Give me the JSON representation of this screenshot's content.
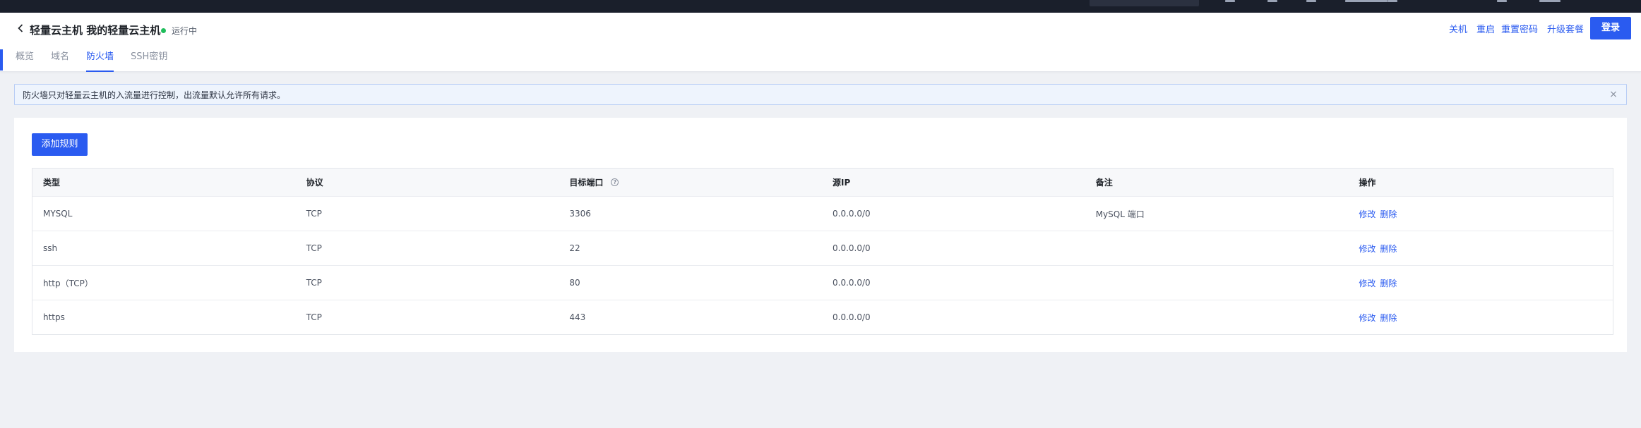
{
  "header": {
    "title": "轻量云主机 我的轻量云主机",
    "status": "运行中",
    "status_color": "#1fbd5b",
    "tabs": [
      {
        "label": "概览"
      },
      {
        "label": "域名"
      },
      {
        "label": "防火墙"
      },
      {
        "label": "SSH密钥"
      }
    ],
    "active_tab": "防火墙",
    "actions": {
      "shutdown": "关机",
      "restart": "重启",
      "reset_password": "重置密码",
      "upgrade": "升级套餐",
      "login": "登录"
    }
  },
  "banner": {
    "text": "防火墙只对轻量云主机的入流量进行控制，出流量默认允许所有请求。"
  },
  "firewall": {
    "add_button": "添加规则",
    "columns": [
      "类型",
      "协议",
      "目标端口",
      "源IP",
      "备注",
      "操作"
    ],
    "rows": [
      {
        "type": "MYSQL",
        "protocol": "TCP",
        "port": "3306",
        "source": "0.0.0.0/0",
        "note": "MySQL 端口",
        "edit": "修改",
        "delete": "删除"
      },
      {
        "type": "ssh",
        "protocol": "TCP",
        "port": "22",
        "source": "0.0.0.0/0",
        "note": "",
        "edit": "修改",
        "delete": "删除"
      },
      {
        "type": "http（TCP）",
        "protocol": "TCP",
        "port": "80",
        "source": "0.0.0.0/0",
        "note": "",
        "edit": "修改",
        "delete": "删除"
      },
      {
        "type": "https",
        "protocol": "TCP",
        "port": "443",
        "source": "0.0.0.0/0",
        "note": "",
        "edit": "修改",
        "delete": "删除"
      }
    ]
  },
  "colors": {
    "accent": "#2a5bf0",
    "topbar": "#1a1f2b",
    "page_bg": "#eff1f5"
  }
}
